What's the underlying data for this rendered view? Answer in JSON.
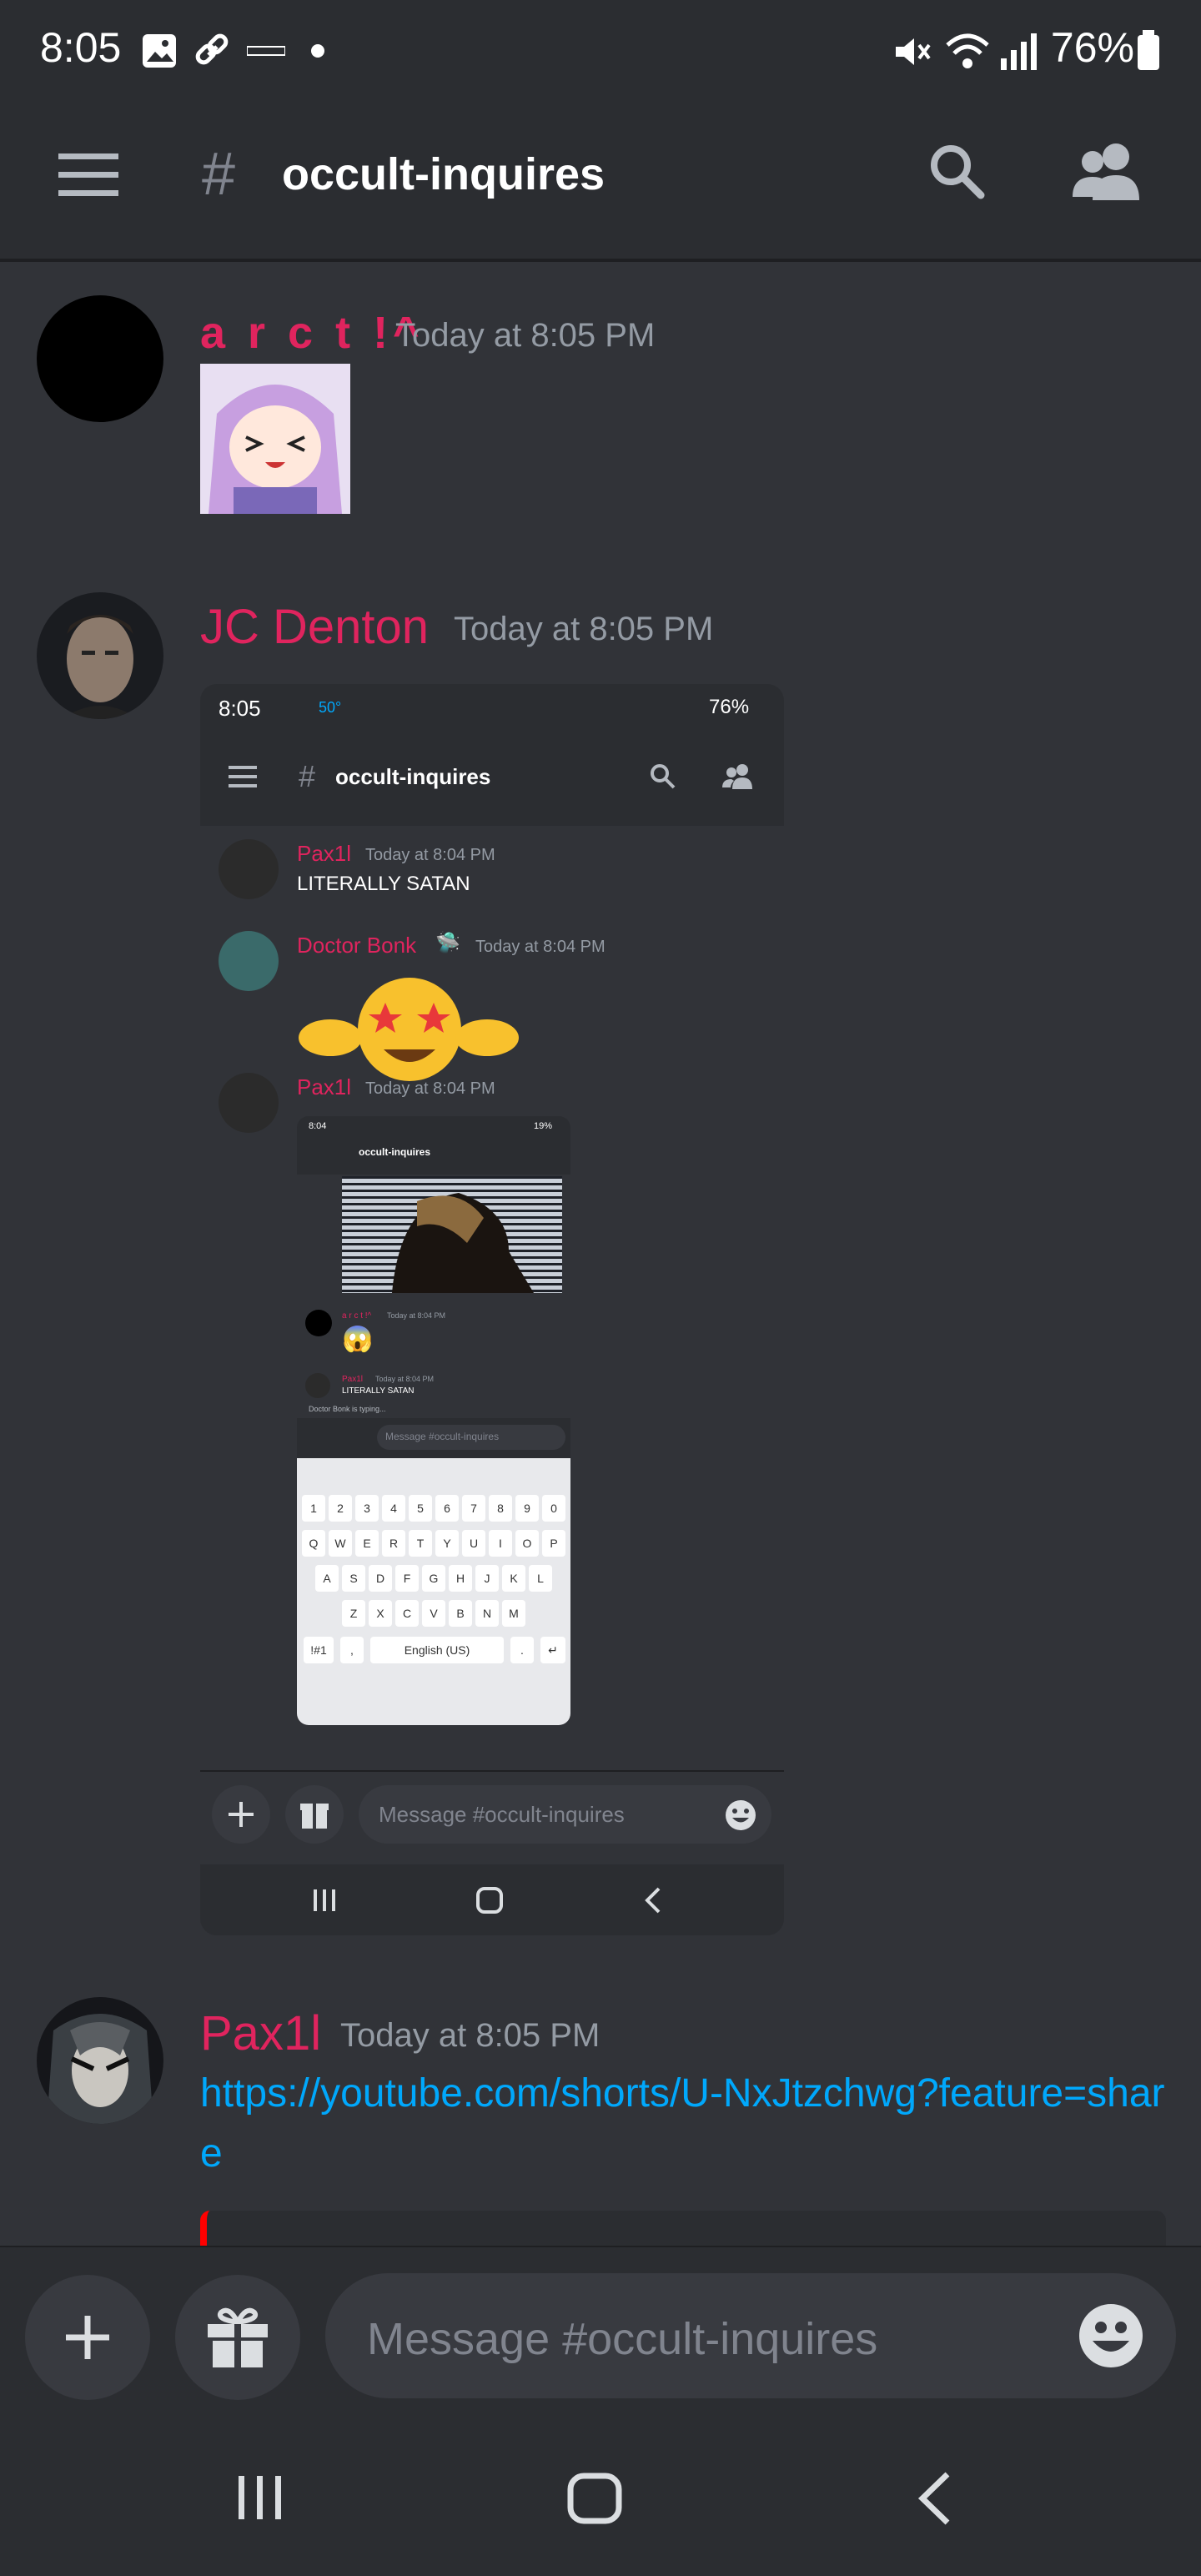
{
  "status_bar": {
    "time": "8:05",
    "battery": "76%",
    "icons": [
      "image-icon",
      "link-icon",
      "wyze-icon",
      "dot-icon",
      "mute-icon",
      "wifi-icon",
      "signal-icon",
      "battery-icon"
    ]
  },
  "header": {
    "channel_hash": "#",
    "channel_name": "occult-inquires"
  },
  "messages": [
    {
      "username": "a r c t !^",
      "timestamp": "Today at 8:05 PM"
    },
    {
      "username": "JC Denton",
      "timestamp": "Today at 8:05 PM"
    },
    {
      "username": "Pax1l",
      "timestamp": "Today at 8:05 PM",
      "text": "https://youtube.com/shorts/U-NxJtzchwg?feature=share"
    }
  ],
  "embedded_screenshot": {
    "status_time": "8:05",
    "status_temp": "50°",
    "status_battery": "76%",
    "channel_hash": "#",
    "channel_name": "occult-inquires",
    "messages": [
      {
        "username": "Pax1l",
        "timestamp": "Today at 8:04 PM",
        "text": "LITERALLY SATAN"
      },
      {
        "username": "Doctor Bonk",
        "timestamp": "Today at 8:04 PM"
      },
      {
        "username": "Pax1l",
        "timestamp": "Today at 8:04 PM"
      }
    ],
    "inner": {
      "time": "8:04",
      "battery": "19%",
      "channel_name": "occult-inquires",
      "msg1_user": "a r c t !^",
      "msg1_ts": "Today at 8:04 PM",
      "msg2_user": "Pax1l",
      "msg2_ts": "Today at 8:04 PM",
      "msg2_text": "LITERALLY SATAN",
      "typing": "Doctor Bonk is typing...",
      "input_placeholder": "Message #occult-inquires",
      "keyboard_rows": [
        [
          "1",
          "2",
          "3",
          "4",
          "5",
          "6",
          "7",
          "8",
          "9",
          "0"
        ],
        [
          "Q",
          "W",
          "E",
          "R",
          "T",
          "Y",
          "U",
          "I",
          "O",
          "P"
        ],
        [
          "A",
          "S",
          "D",
          "F",
          "G",
          "H",
          "J",
          "K",
          "L"
        ],
        [
          "Z",
          "X",
          "C",
          "V",
          "B",
          "N",
          "M"
        ]
      ],
      "sym_key": "!#1",
      "space_key": "English (US)",
      "comma": ",",
      "period": "."
    },
    "input_placeholder": "Message #occult-inquires"
  },
  "composer": {
    "placeholder": "Message #occult-inquires"
  },
  "colors": {
    "bg": "#313338",
    "bar": "#2b2d31",
    "username": "#e0245e",
    "link": "#00a8fc"
  }
}
